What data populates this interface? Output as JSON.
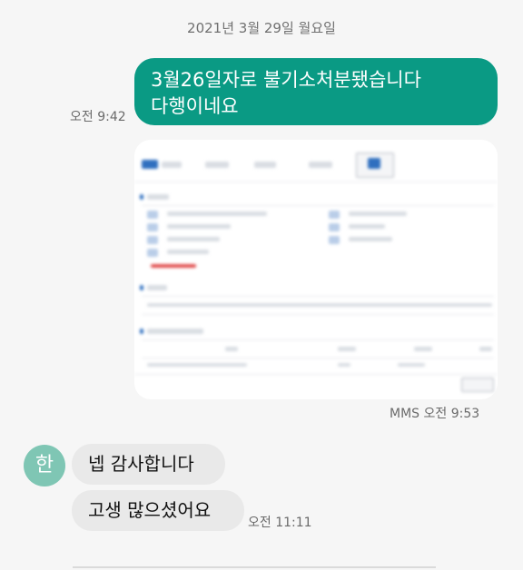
{
  "date_separator": "2021년 3월 29일 월요일",
  "sent_message": {
    "lines": [
      "3월26일자로 불기소처분됐습니다",
      "다행이네요"
    ],
    "time": "오전 9:42"
  },
  "mms_message": {
    "time": "MMS 오전 9:53"
  },
  "sender": {
    "avatar_initial": "한"
  },
  "received_messages": [
    {
      "text": "넵 감사합니다"
    },
    {
      "text": "고생 많으셨어요",
      "time": "오전 11:11"
    }
  ],
  "colors": {
    "sent_bubble": "#0a9a84",
    "received_bubble": "#e9e9e9",
    "avatar": "#7fc6b4",
    "background": "#f6f6f6"
  }
}
